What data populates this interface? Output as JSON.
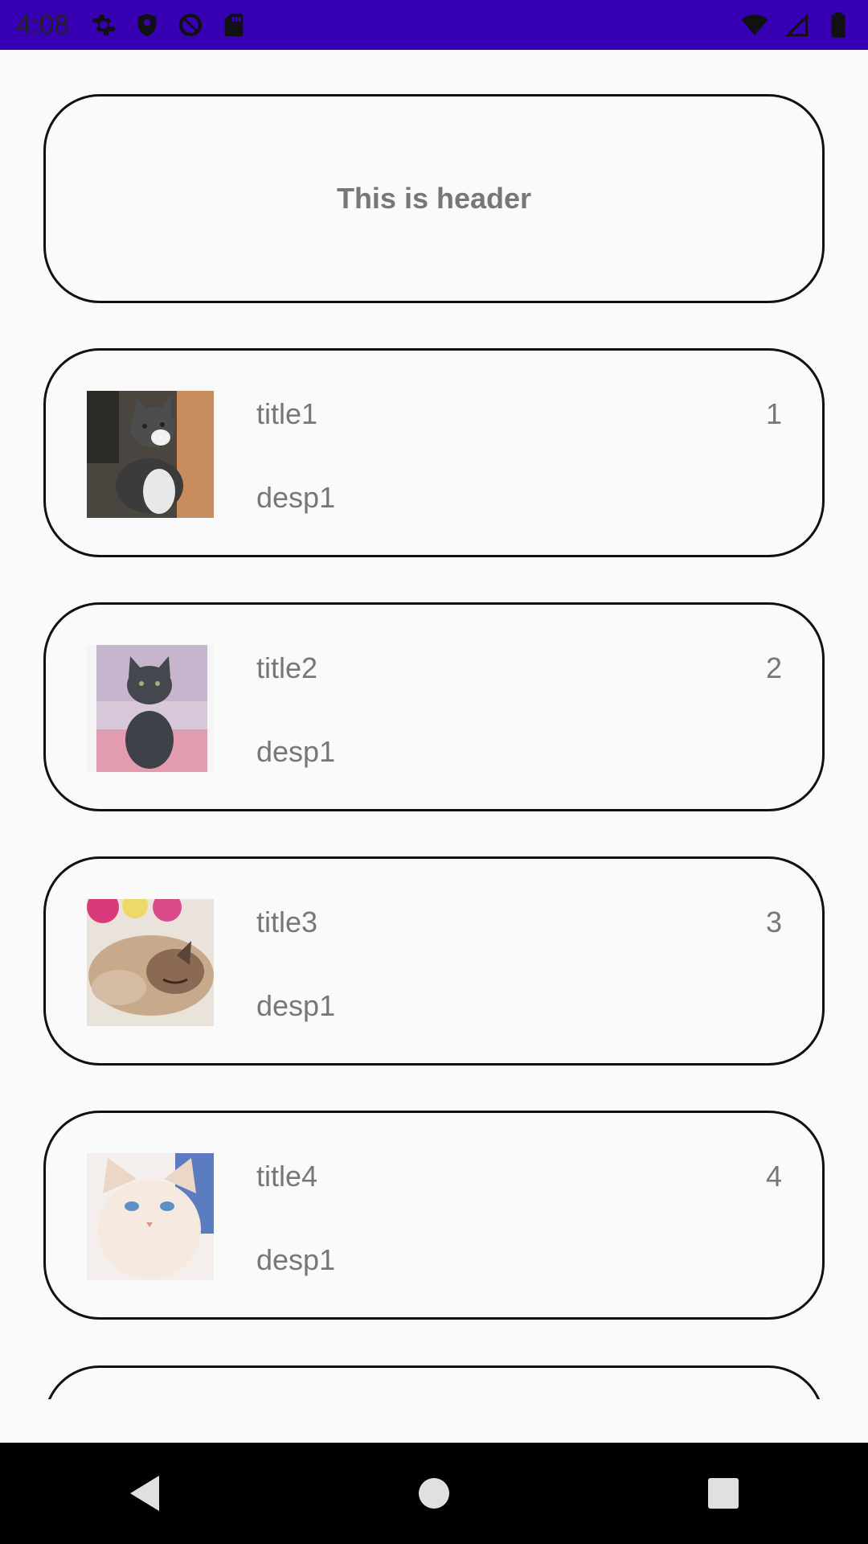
{
  "status_bar": {
    "time": "4:08",
    "left_icons": [
      "gear-icon",
      "shield-icon",
      "at-sign-icon",
      "sd-card-icon"
    ],
    "right_icons": [
      "wifi-icon",
      "signal-icon",
      "battery-icon"
    ],
    "background": "#3700b3"
  },
  "header": {
    "text": "This is header"
  },
  "items": [
    {
      "title": "title1",
      "desc": "desp1",
      "count": "1",
      "image": "gray-white-kitten-photo"
    },
    {
      "title": "title2",
      "desc": "desp1",
      "count": "2",
      "image": "gray-kitten-photo"
    },
    {
      "title": "title3",
      "desc": "desp1",
      "count": "3",
      "image": "sleeping-cat-photo"
    },
    {
      "title": "title4",
      "desc": "desp1",
      "count": "4",
      "image": "white-cat-photo"
    }
  ],
  "nav_bar": {
    "buttons": [
      "back-icon",
      "home-icon",
      "recents-icon"
    ]
  }
}
